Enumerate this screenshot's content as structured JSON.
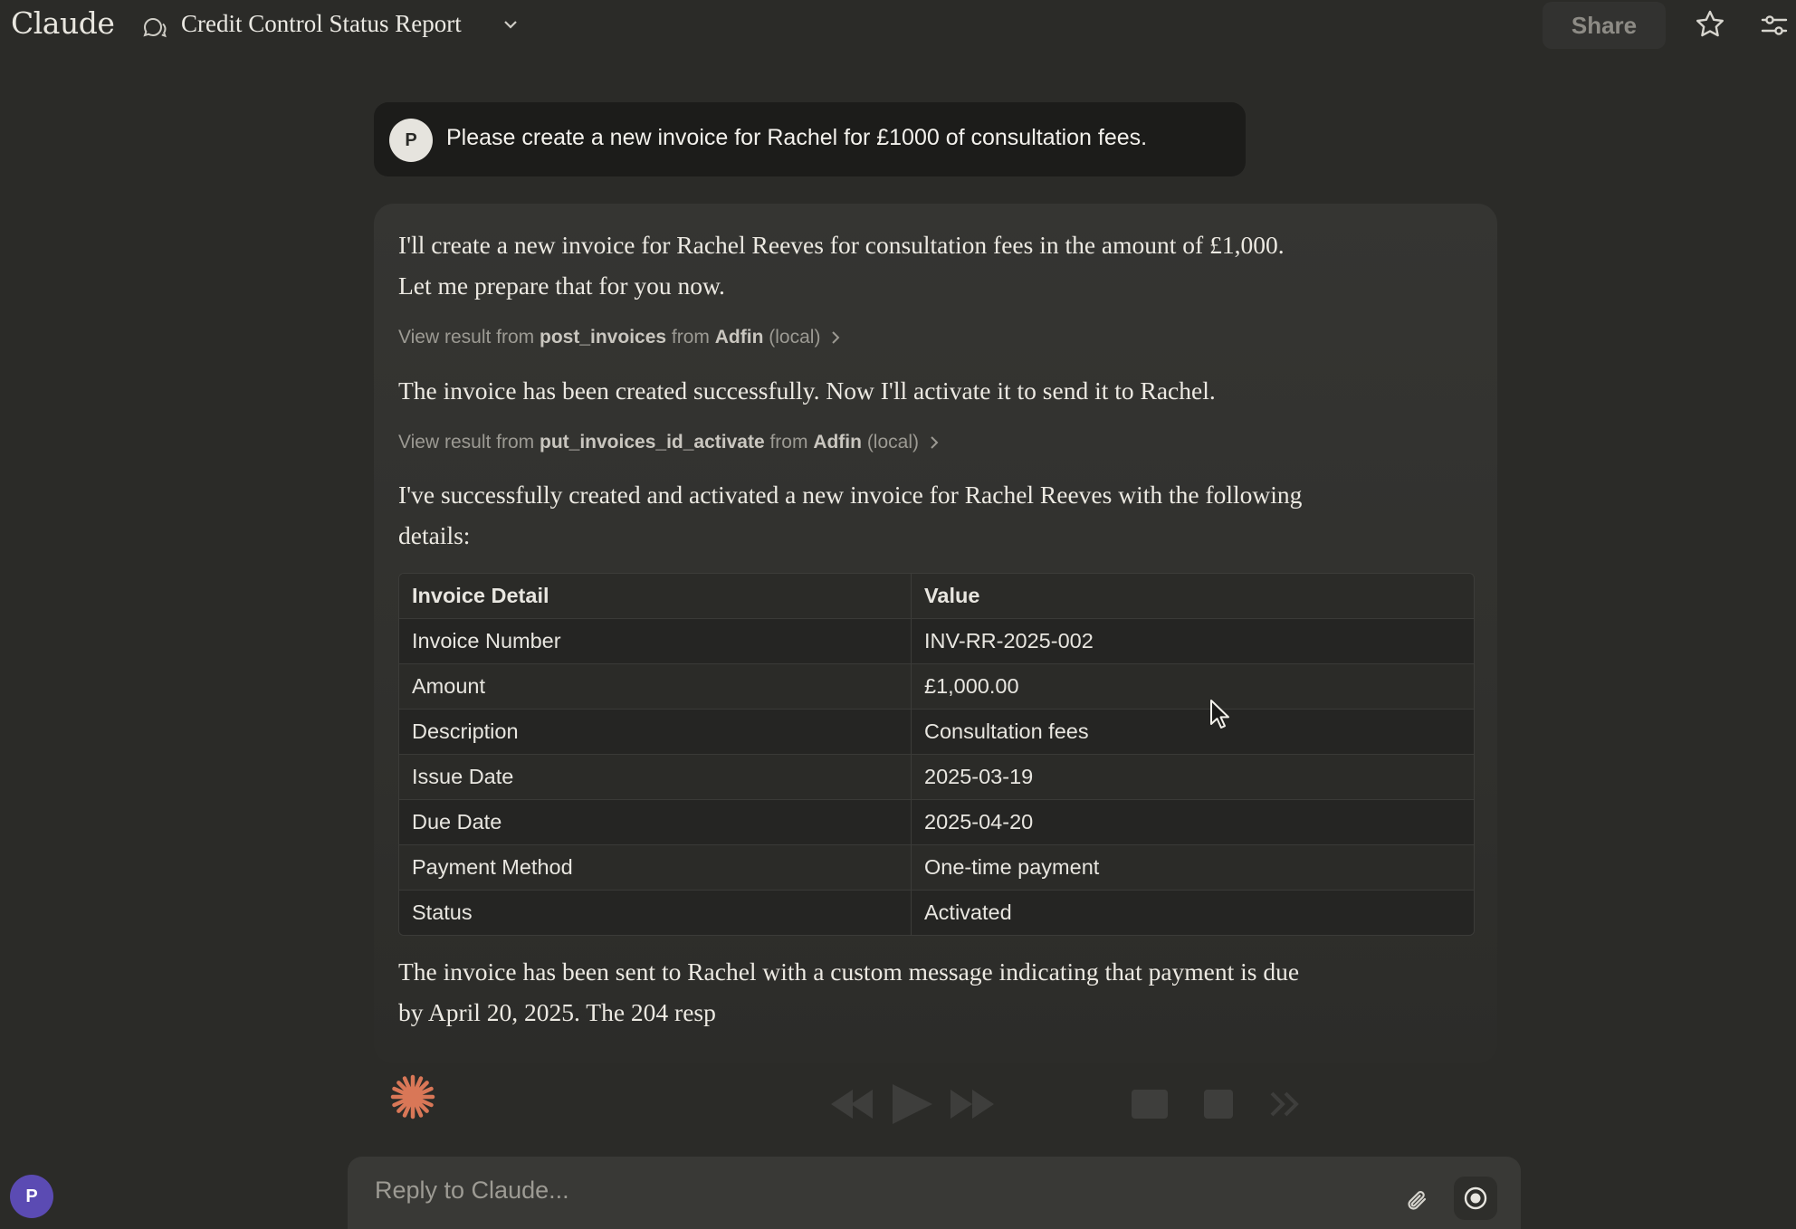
{
  "header": {
    "logo": "Claude",
    "conversation_title": "Credit Control Status Report",
    "share_label": "Share"
  },
  "user_message": {
    "avatar_initial": "P",
    "text": "Please create a new invoice for Rachel for £1000 of consultation fees."
  },
  "assistant_reply": {
    "para1_line1": "I'll create a new invoice for Rachel Reeves for consultation fees in the amount of £1,000.",
    "para1_line2": "Let me prepare that for you now.",
    "tool1": {
      "prefix": "View result from",
      "tool": "post_invoices",
      "mid": "from",
      "server": "Adfin",
      "suffix": "(local)"
    },
    "para2": "The invoice has been created successfully. Now I'll activate it to send it to Rachel.",
    "tool2": {
      "prefix": "View result from",
      "tool": "put_invoices_id_activate",
      "mid": "from",
      "server": "Adfin",
      "suffix": "(local)"
    },
    "para3_line1": "I've successfully created and activated a new invoice for Rachel Reeves with the following",
    "para3_line2": "details:",
    "table": {
      "headers": [
        "Invoice Detail",
        "Value"
      ],
      "rows": [
        [
          "Invoice Number",
          "INV-RR-2025-002"
        ],
        [
          "Amount",
          "£1,000.00"
        ],
        [
          "Description",
          "Consultation fees"
        ],
        [
          "Issue Date",
          "2025-03-19"
        ],
        [
          "Due Date",
          "2025-04-20"
        ],
        [
          "Payment Method",
          "One-time payment"
        ],
        [
          "Status",
          "Activated"
        ]
      ]
    },
    "para4_line1": "The invoice has been sent to Rachel with a custom message indicating that payment is due",
    "para4_line2": "by April 20, 2025. The 204 resp"
  },
  "composer": {
    "placeholder": "Reply to Claude..."
  },
  "sidebar": {
    "avatar_initial": "P"
  },
  "colors": {
    "background": "#2b2b28",
    "user_bubble": "#1c1c1a",
    "accent_spark": "#d97757",
    "side_avatar": "#5b4bb3"
  },
  "icons": [
    "chat-bubble-icon",
    "chevron-down-icon",
    "star-icon",
    "settings-sliders-icon",
    "chevron-right-icon",
    "claude-spark-icon",
    "paperclip-icon",
    "record-icon",
    "mouse-cursor-icon"
  ]
}
